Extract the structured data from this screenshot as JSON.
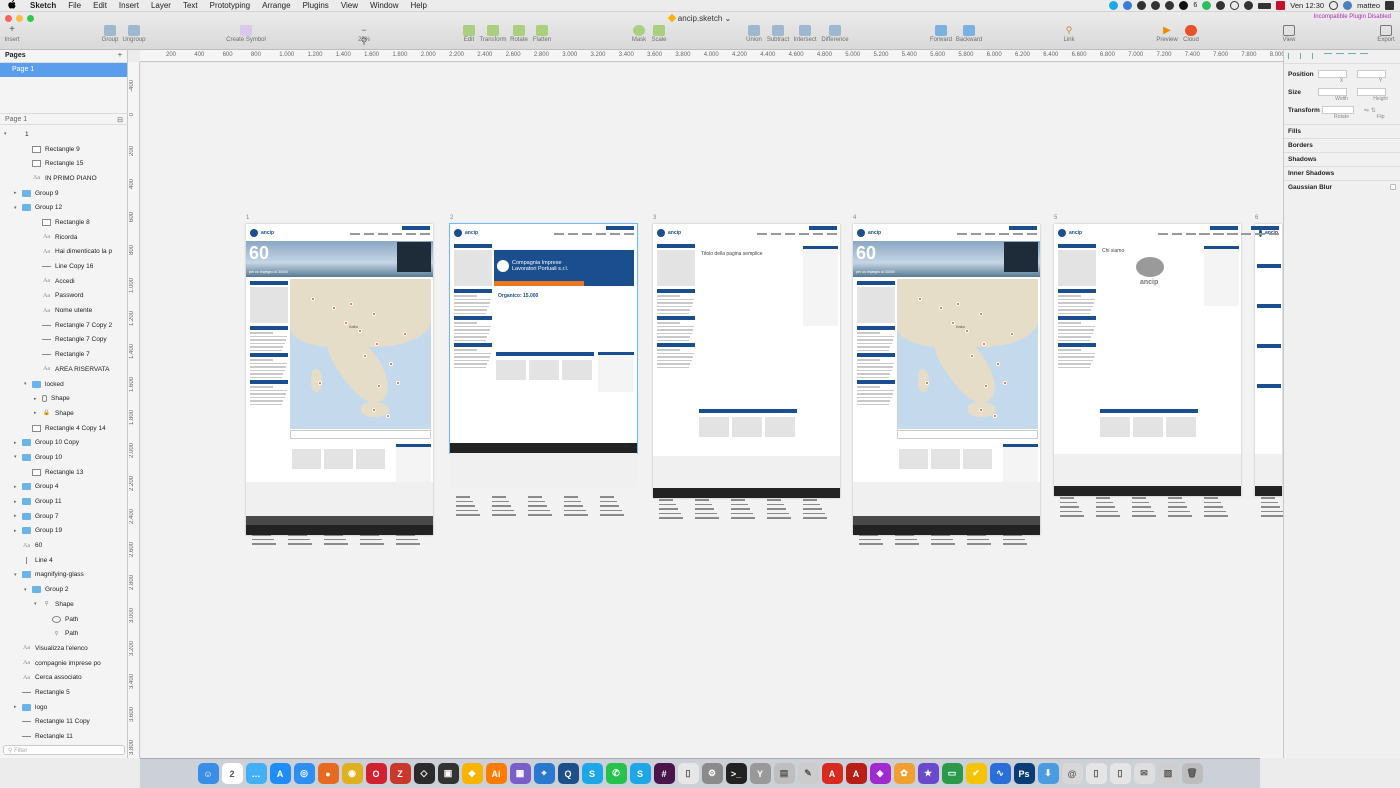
{
  "menubar": {
    "apple": "",
    "app_name": "Sketch",
    "items": [
      "File",
      "Edit",
      "Insert",
      "Layer",
      "Text",
      "Prototyping",
      "Arrange",
      "Plugins",
      "View",
      "Window",
      "Help"
    ],
    "battery_pct": "6",
    "clock": "Ven 12:30",
    "user": "matteo"
  },
  "window": {
    "title": "ancip.sketch",
    "plugin_badge": "Incompatible Plugin Disabled"
  },
  "toolbar": {
    "insert": "Insert",
    "group": "Group",
    "ungroup": "Ungroup",
    "create_symbol": "Create Symbol",
    "zoom": "25%",
    "edit": "Edit",
    "transform": "Transform",
    "rotate": "Rotate",
    "flatten": "Flatten",
    "mask": "Mask",
    "scale": "Scale",
    "union": "Union",
    "subtract": "Subtract",
    "intersect": "Intersect",
    "difference": "Difference",
    "forward": "Forward",
    "backward": "Backward",
    "link": "Link",
    "preview": "Preview",
    "cloud": "Cloud",
    "view": "View",
    "export": "Export"
  },
  "ruler_h": [
    "200",
    "400",
    "600",
    "800",
    "1.000",
    "1.200",
    "1.400",
    "1.600",
    "1.800",
    "2.000",
    "2.200",
    "2.400",
    "2.600",
    "2.800",
    "3.000",
    "3.200",
    "3.400",
    "3.600",
    "3.800",
    "4.000",
    "4.200",
    "4.400",
    "4.600",
    "4.800",
    "5.000",
    "5.200",
    "5.400",
    "5.600",
    "5.800",
    "6.000",
    "6.200",
    "6.400",
    "6.600",
    "6.800",
    "7.000",
    "7.200",
    "7.400",
    "7.600",
    "7.800",
    "8.000",
    "8.200"
  ],
  "ruler_v": [
    "-400",
    "0",
    "200",
    "400",
    "600",
    "800",
    "1.000",
    "1.200",
    "1.400",
    "1.600",
    "1.800",
    "2.000",
    "2.200",
    "2.400",
    "2.600",
    "2.800",
    "3.000",
    "3.200",
    "3.400",
    "3.600",
    "3.800",
    "4.000"
  ],
  "pages_panel": {
    "title": "Pages",
    "selected_page": "Page 1",
    "current_page": "Page 1",
    "filter_placeholder": "Filter"
  },
  "layers": [
    {
      "name": "1",
      "type": "artboard",
      "indent": 0,
      "arrow": "▾"
    },
    {
      "name": "Rectangle 9",
      "type": "rect",
      "indent": 2,
      "arrow": ""
    },
    {
      "name": "Rectangle 15",
      "type": "rect",
      "indent": 2,
      "arrow": ""
    },
    {
      "name": "IN PRIMO PIANO",
      "type": "text",
      "indent": 2,
      "arrow": ""
    },
    {
      "name": "Group 9",
      "type": "folder",
      "indent": 1,
      "arrow": "▸"
    },
    {
      "name": "Group 12",
      "type": "folder",
      "indent": 1,
      "arrow": "▾"
    },
    {
      "name": "Rectangle 8",
      "type": "rect",
      "indent": 3,
      "arrow": ""
    },
    {
      "name": "Ricorda",
      "type": "text",
      "indent": 3,
      "arrow": ""
    },
    {
      "name": "Hai dimenticato la p",
      "type": "text",
      "indent": 3,
      "arrow": ""
    },
    {
      "name": "Line Copy 16",
      "type": "line",
      "indent": 3,
      "arrow": ""
    },
    {
      "name": "Accedi",
      "type": "text",
      "indent": 3,
      "arrow": ""
    },
    {
      "name": "Password",
      "type": "text",
      "indent": 3,
      "arrow": ""
    },
    {
      "name": "Nome utente",
      "type": "text",
      "indent": 3,
      "arrow": ""
    },
    {
      "name": "Rectangle 7 Copy 2",
      "type": "line",
      "indent": 3,
      "arrow": ""
    },
    {
      "name": "Rectangle 7 Copy",
      "type": "line",
      "indent": 3,
      "arrow": ""
    },
    {
      "name": "Rectangle 7",
      "type": "line",
      "indent": 3,
      "arrow": ""
    },
    {
      "name": "AREA RISERVATA",
      "type": "text",
      "indent": 3,
      "arrow": ""
    },
    {
      "name": "locked",
      "type": "folder",
      "indent": 2,
      "arrow": "▾"
    },
    {
      "name": "Shape",
      "type": "shape",
      "indent": 3,
      "arrow": "▸"
    },
    {
      "name": "Shape",
      "type": "lock",
      "indent": 3,
      "arrow": "▸"
    },
    {
      "name": "Rectangle 4 Copy 14",
      "type": "rect",
      "indent": 2,
      "arrow": ""
    },
    {
      "name": "Group 10 Copy",
      "type": "folder",
      "indent": 1,
      "arrow": "▸"
    },
    {
      "name": "Group 10",
      "type": "folder",
      "indent": 1,
      "arrow": "▾"
    },
    {
      "name": "Rectangle 13",
      "type": "rect",
      "indent": 2,
      "arrow": ""
    },
    {
      "name": "Group 4",
      "type": "folder",
      "indent": 1,
      "arrow": "▸"
    },
    {
      "name": "Group 11",
      "type": "folder",
      "indent": 1,
      "arrow": "▸"
    },
    {
      "name": "Group 7",
      "type": "folder",
      "indent": 1,
      "arrow": "▸"
    },
    {
      "name": "Group 19",
      "type": "folder",
      "indent": 1,
      "arrow": "▸"
    },
    {
      "name": "60",
      "type": "text",
      "indent": 1,
      "arrow": ""
    },
    {
      "name": "Line 4",
      "type": "vline",
      "indent": 1,
      "arrow": ""
    },
    {
      "name": "magnifying-glass",
      "type": "folder",
      "indent": 1,
      "arrow": "▾"
    },
    {
      "name": "Group 2",
      "type": "folder",
      "indent": 2,
      "arrow": "▾"
    },
    {
      "name": "Shape",
      "type": "search",
      "indent": 3,
      "arrow": "▾"
    },
    {
      "name": "Path",
      "type": "circle",
      "indent": 4,
      "arrow": ""
    },
    {
      "name": "Path",
      "type": "search",
      "indent": 4,
      "arrow": ""
    },
    {
      "name": "Visualizza l'elenco",
      "type": "text",
      "indent": 1,
      "arrow": ""
    },
    {
      "name": "compagnie imprese po",
      "type": "text",
      "indent": 1,
      "arrow": ""
    },
    {
      "name": "Cerca associato",
      "type": "text",
      "indent": 1,
      "arrow": ""
    },
    {
      "name": "Rectangle 5",
      "type": "line",
      "indent": 1,
      "arrow": ""
    },
    {
      "name": "logo",
      "type": "folder",
      "indent": 1,
      "arrow": "▸"
    },
    {
      "name": "Rectangle 11 Copy",
      "type": "line",
      "indent": 1,
      "arrow": ""
    },
    {
      "name": "Rectangle 11",
      "type": "line",
      "indent": 1,
      "arrow": ""
    }
  ],
  "artboards": [
    {
      "label": "1",
      "variant": "home",
      "hero": "60",
      "sub": "per un impegno di 30000"
    },
    {
      "label": "2",
      "variant": "company",
      "company": "Compagnia Imprese Lavoratori Portuali s.r.l.",
      "organico": "Organico: 15.000"
    },
    {
      "label": "3",
      "variant": "page",
      "title": "Titolo della pagina semplice"
    },
    {
      "label": "4",
      "variant": "home",
      "hero": "60",
      "sub": "per un impegno di 30000"
    },
    {
      "label": "5",
      "variant": "about",
      "title": "Chi siamo",
      "logo": "ancip"
    },
    {
      "label": "6",
      "variant": "partial"
    }
  ],
  "artboard_brand": "ancip",
  "map_label": "Italia",
  "inspector": {
    "position": "Position",
    "x": "X",
    "y": "Y",
    "size": "Size",
    "width": "Width",
    "height": "Height",
    "transform": "Transform",
    "rotate": "Rotate",
    "flip": "Flip",
    "sections": [
      "Fills",
      "Borders",
      "Shadows",
      "Inner Shadows",
      "Gaussian Blur"
    ]
  },
  "dock": [
    {
      "name": "finder",
      "color": "#3a8ee6",
      "glyph": "☺"
    },
    {
      "name": "calendar",
      "color": "#ffffff",
      "glyph": "2"
    },
    {
      "name": "messages",
      "color": "#43b0f5",
      "glyph": "…"
    },
    {
      "name": "app-store",
      "color": "#1f8df5",
      "glyph": "A"
    },
    {
      "name": "safari",
      "color": "#2f8ff0",
      "glyph": "◎"
    },
    {
      "name": "firefox",
      "color": "#e66a1f",
      "glyph": "●"
    },
    {
      "name": "chrome",
      "color": "#e0b020",
      "glyph": "◉"
    },
    {
      "name": "opera",
      "color": "#d0232f",
      "glyph": "O"
    },
    {
      "name": "filezilla",
      "color": "#c8382b",
      "glyph": "Z"
    },
    {
      "name": "code-editor",
      "color": "#2b2b2b",
      "glyph": "◇"
    },
    {
      "name": "terminal-alt",
      "color": "#333333",
      "glyph": "▣"
    },
    {
      "name": "sketch",
      "color": "#f7b500",
      "glyph": "◆"
    },
    {
      "name": "illustrator",
      "color": "#ff7c00",
      "glyph": "Ai"
    },
    {
      "name": "box",
      "color": "#7a5fcb",
      "glyph": "▦"
    },
    {
      "name": "maps",
      "color": "#2a78d0",
      "glyph": "⌖"
    },
    {
      "name": "quicktime",
      "color": "#1d4f8a",
      "glyph": "Q"
    },
    {
      "name": "skype",
      "color": "#1ea7e8",
      "glyph": "S"
    },
    {
      "name": "whatsapp",
      "color": "#27c24c",
      "glyph": "✆"
    },
    {
      "name": "skype-2",
      "color": "#1ea7e8",
      "glyph": "S"
    },
    {
      "name": "slack",
      "color": "#4a154b",
      "glyph": "#"
    },
    {
      "name": "preview",
      "color": "#e7e7e7",
      "glyph": "▯"
    },
    {
      "name": "system-prefs",
      "color": "#8a8a8a",
      "glyph": "⚙"
    },
    {
      "name": "terminal",
      "color": "#222222",
      "glyph": ">_"
    },
    {
      "name": "tower",
      "color": "#999999",
      "glyph": "Y"
    },
    {
      "name": "notes",
      "color": "#bfbfbf",
      "glyph": "▤"
    },
    {
      "name": "script-editor",
      "color": "#cccccc",
      "glyph": "✎"
    },
    {
      "name": "acrobat",
      "color": "#d92a20",
      "glyph": "A"
    },
    {
      "name": "acrobat-2",
      "color": "#b81d16",
      "glyph": "A"
    },
    {
      "name": "affinity",
      "color": "#a02ad0",
      "glyph": "◈"
    },
    {
      "name": "photos",
      "color": "#f0a030",
      "glyph": "✿"
    },
    {
      "name": "imovie",
      "color": "#6a4acb",
      "glyph": "★"
    },
    {
      "name": "screen",
      "color": "#2a9a4a",
      "glyph": "▭"
    },
    {
      "name": "todo",
      "color": "#f5c400",
      "glyph": "✔"
    },
    {
      "name": "soundwave",
      "color": "#2a6fd8",
      "glyph": "∿"
    },
    {
      "name": "photoshop",
      "color": "#0c3c78",
      "glyph": "Ps"
    },
    {
      "name": "downloads",
      "color": "#4a9be0",
      "glyph": "⬇"
    },
    {
      "name": "mail",
      "color": "#d7d7d7",
      "glyph": "@"
    },
    {
      "name": "documents",
      "color": "#e5e5e5",
      "glyph": "▯"
    },
    {
      "name": "docs-2",
      "color": "#e5e5e5",
      "glyph": "▯"
    },
    {
      "name": "mail-stack",
      "color": "#dedede",
      "glyph": "✉"
    },
    {
      "name": "pictures",
      "color": "#cfcfcf",
      "glyph": "▧"
    },
    {
      "name": "trash",
      "color": "#bdbdbd",
      "glyph": "🗑"
    }
  ]
}
